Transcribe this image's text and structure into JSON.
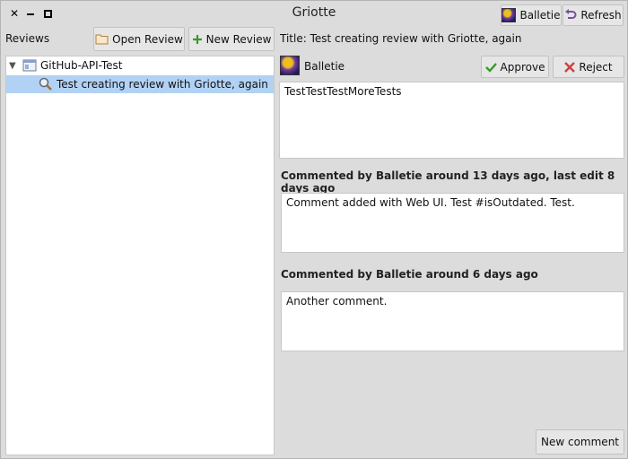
{
  "window": {
    "title": "Griotte",
    "controls": [
      "close-icon",
      "minimize-icon",
      "maximize-icon"
    ]
  },
  "toolbar": {
    "user_label": "Balletie",
    "refresh_label": "Refresh"
  },
  "left": {
    "reviews_label": "Reviews",
    "open_review_label": "Open Review",
    "new_review_label": "New Review",
    "tree": {
      "repo": "GitHub-API-Test",
      "review": "Test creating review with Griotte, again"
    }
  },
  "right": {
    "title": "Title: Test creating review with Griotte, again",
    "author": "Balletie",
    "approve_label": "Approve",
    "reject_label": "Reject",
    "description": "TestTestTestMoreTests",
    "comments": [
      {
        "header": "Commented by Balletie around 13 days ago, last edit 8 days ago",
        "body": "Comment added with Web UI. Test #isOutdated. Test."
      },
      {
        "header": "Commented by Balletie around 6 days ago",
        "body": "Another comment."
      }
    ],
    "new_comment_label": "New comment"
  },
  "colors": {
    "background": "#dcdcdc",
    "selection": "#b2d2f5",
    "approve_icon": "#3a9a2a",
    "reject_icon": "#d04040",
    "refresh_icon": "#7a4fa0"
  }
}
